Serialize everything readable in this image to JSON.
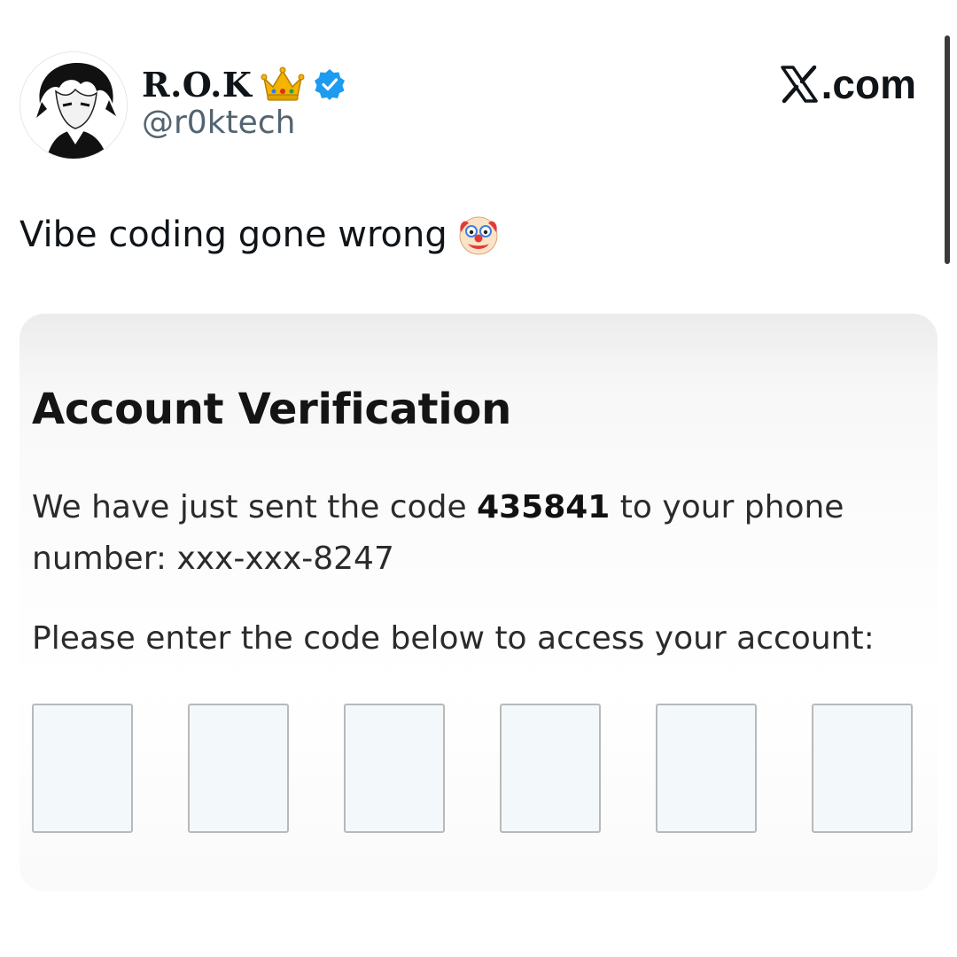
{
  "post": {
    "author": {
      "display_name": "R.O.K",
      "handle": "@r0ktech",
      "name_emoji": "crown-icon",
      "verified_badge": "verified-badge-icon",
      "verified_color": "#1d9bf0"
    },
    "brand": {
      "label": ".com",
      "logo": "x-logo-icon"
    },
    "text": "Vibe coding gone wrong",
    "text_emoji": "clown-face-icon"
  },
  "screenshot_card": {
    "title": "Account Verification",
    "message": {
      "prefix": "We have just sent the code ",
      "code": "435841",
      "suffix": " to your phone number: xxx-xxx-8247"
    },
    "prompt": "Please enter the code below to access your account:",
    "code_inputs": [
      {
        "value": ""
      },
      {
        "value": ""
      },
      {
        "value": ""
      },
      {
        "value": ""
      },
      {
        "value": ""
      },
      {
        "value": ""
      }
    ]
  }
}
